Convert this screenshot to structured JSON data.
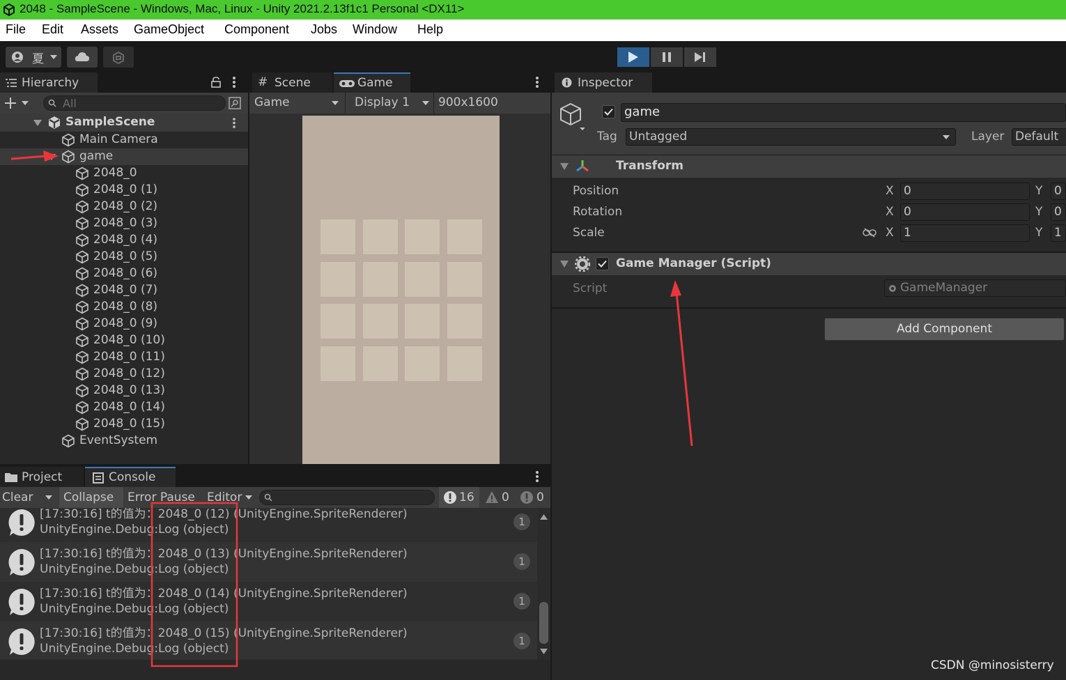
{
  "window": {
    "title": "2048 - SampleScene - Windows, Mac, Linux - Unity 2021.2.13f1c1 Personal <DX11>"
  },
  "menu": [
    "File",
    "Edit",
    "Assets",
    "GameObject",
    "Component",
    "Jobs",
    "Window",
    "Help"
  ],
  "toolbar": {
    "account": "夏",
    "play_state": "playing"
  },
  "hierarchy": {
    "tab": "Hierarchy",
    "search_placeholder": "All",
    "scene": "SampleScene",
    "items": [
      {
        "label": "Main Camera",
        "depth": 1
      },
      {
        "label": "game",
        "depth": 1,
        "selected": true
      },
      {
        "label": "2048_0",
        "depth": 2
      },
      {
        "label": "2048_0 (1)",
        "depth": 2
      },
      {
        "label": "2048_0 (2)",
        "depth": 2
      },
      {
        "label": "2048_0 (3)",
        "depth": 2
      },
      {
        "label": "2048_0 (4)",
        "depth": 2
      },
      {
        "label": "2048_0 (5)",
        "depth": 2
      },
      {
        "label": "2048_0 (6)",
        "depth": 2
      },
      {
        "label": "2048_0 (7)",
        "depth": 2
      },
      {
        "label": "2048_0 (8)",
        "depth": 2
      },
      {
        "label": "2048_0 (9)",
        "depth": 2
      },
      {
        "label": "2048_0 (10)",
        "depth": 2
      },
      {
        "label": "2048_0 (11)",
        "depth": 2
      },
      {
        "label": "2048_0 (12)",
        "depth": 2
      },
      {
        "label": "2048_0 (13)",
        "depth": 2
      },
      {
        "label": "2048_0 (14)",
        "depth": 2
      },
      {
        "label": "2048_0 (15)",
        "depth": 2
      },
      {
        "label": "EventSystem",
        "depth": 1
      }
    ]
  },
  "game_view": {
    "tabs": [
      "Scene",
      "Game"
    ],
    "mode": "Game",
    "display": "Display 1",
    "resolution": "900x1600",
    "board_color": "#bbada0",
    "tile_color": "#cdc1b2",
    "grid_size": 4
  },
  "inspector": {
    "tab": "Inspector",
    "object_name": "game",
    "tag_label": "Tag",
    "tag_value": "Untagged",
    "layer_label": "Layer",
    "layer_value": "Default",
    "transform": {
      "title": "Transform",
      "rows": [
        {
          "label": "Position",
          "x": "0",
          "y": "0"
        },
        {
          "label": "Rotation",
          "x": "0",
          "y": "0"
        },
        {
          "label": "Scale",
          "x": "1",
          "y": "1"
        }
      ]
    },
    "script_component": {
      "title": "Game Manager (Script)",
      "script_label": "Script",
      "script_value": "GameManager"
    },
    "add_component": "Add Component"
  },
  "bottom": {
    "tabs": [
      "Project",
      "Console"
    ],
    "buttons": {
      "clear": "Clear",
      "collapse": "Collapse",
      "error_pause": "Error Pause",
      "editor": "Editor"
    },
    "counts": {
      "logs": "16",
      "warnings": "0",
      "errors": "0"
    },
    "entries": [
      {
        "line1": "[17:30:16] t的值为：2048_0 (12) (UnityEngine.SpriteRenderer)",
        "line2": "UnityEngine.Debug:Log (object)",
        "count": "1"
      },
      {
        "line1": "[17:30:16] t的值为：2048_0 (13) (UnityEngine.SpriteRenderer)",
        "line2": "UnityEngine.Debug:Log (object)",
        "count": "1"
      },
      {
        "line1": "[17:30:16] t的值为：2048_0 (14) (UnityEngine.SpriteRenderer)",
        "line2": "UnityEngine.Debug:Log (object)",
        "count": "1"
      },
      {
        "line1": "[17:30:16] t的值为：2048_0 (15) (UnityEngine.SpriteRenderer)",
        "line2": "UnityEngine.Debug:Log (object)",
        "count": "1"
      }
    ]
  },
  "watermark": "CSDN @minosisterry",
  "annotation_color": "#e8373b"
}
